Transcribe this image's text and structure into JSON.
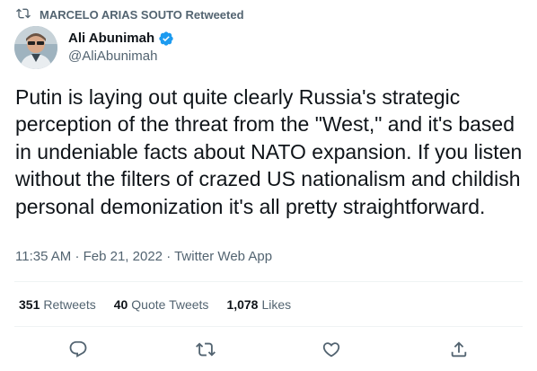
{
  "retweet_banner": {
    "text": "MARCELO ARIAS SOUTO Retweeted",
    "icon": "retweet-icon"
  },
  "author": {
    "display_name": "Ali Abunimah",
    "handle": "@AliAbunimah",
    "verified": true,
    "verified_color": "#1d9bf0"
  },
  "tweet": {
    "text": "Putin is laying out quite clearly Russia's strategic perception of the threat from the \"West,\" and it's based in undeniable facts about NATO expansion. If you listen without the filters of crazed US nationalism and childish personal demonization it's all pretty straightforward.",
    "time": "11:35 AM",
    "date": "Feb 21, 2022",
    "source": "Twitter Web App",
    "separator": "·"
  },
  "stats": {
    "retweets": {
      "count": "351",
      "label": "Retweets"
    },
    "quotes": {
      "count": "40",
      "label": "Quote Tweets"
    },
    "likes": {
      "count": "1,078",
      "label": "Likes"
    }
  },
  "actions": [
    {
      "name": "reply",
      "icon": "reply-icon"
    },
    {
      "name": "retweet",
      "icon": "retweet-icon"
    },
    {
      "name": "like",
      "icon": "heart-icon"
    },
    {
      "name": "share",
      "icon": "share-icon"
    }
  ],
  "colors": {
    "text": "#0f1419",
    "secondary": "#536471",
    "divider": "#eff3f4"
  }
}
